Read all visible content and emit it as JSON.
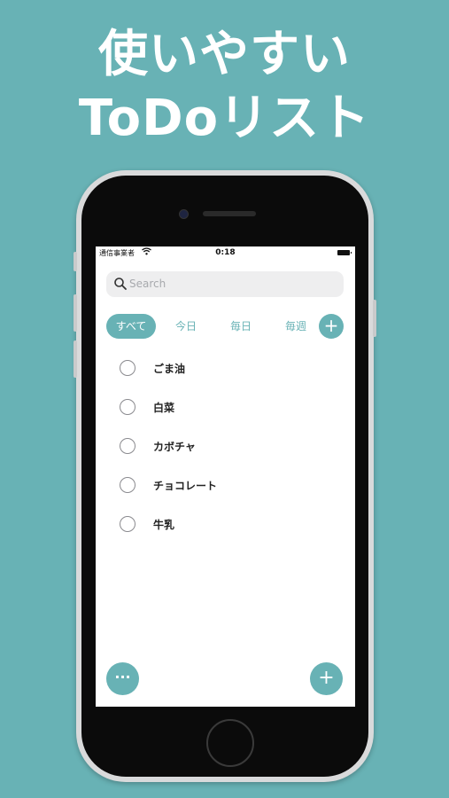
{
  "headline": {
    "line1": "使いやすい",
    "line2": "ToDoリスト"
  },
  "statusbar": {
    "carrier": "通信事業者",
    "time": "0:18"
  },
  "search": {
    "placeholder": "Search"
  },
  "tabs": [
    {
      "label": "すべて",
      "active": true
    },
    {
      "label": "今日",
      "active": false
    },
    {
      "label": "毎日",
      "active": false
    },
    {
      "label": "毎週",
      "active": false
    }
  ],
  "tab_add_label": "+",
  "todos": [
    {
      "label": "ごま油"
    },
    {
      "label": "白菜"
    },
    {
      "label": "カボチャ"
    },
    {
      "label": "チョコレート"
    },
    {
      "label": "牛乳"
    }
  ],
  "fab": {
    "more_label": "···",
    "add_label": "+"
  },
  "colors": {
    "accent": "#68b2b5",
    "background": "#68b2b5"
  }
}
